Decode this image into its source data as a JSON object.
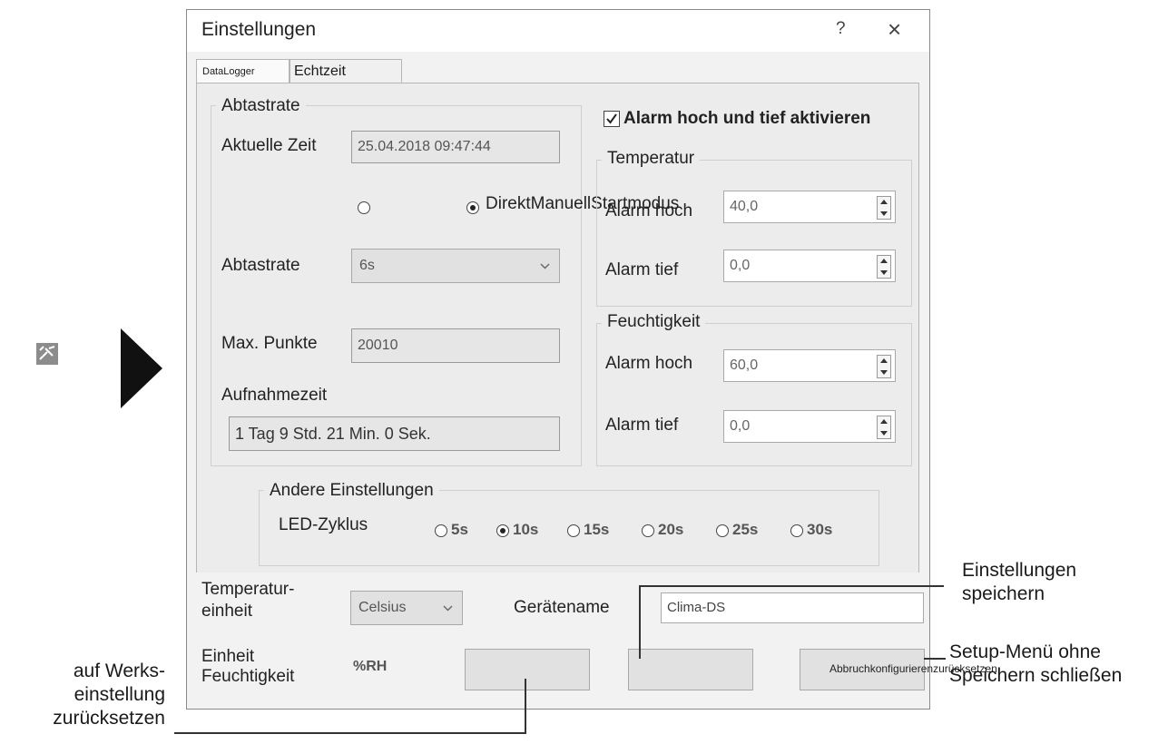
{
  "dialog": {
    "title": "Einstellungen",
    "help_label": "?",
    "close_label": "×"
  },
  "tabs": [
    {
      "label": "DataLogger"
    },
    {
      "label": "Echtzeit"
    }
  ],
  "abtastrate_group": {
    "title": "Abtastrate",
    "aktuelle_zeit_label": "Aktuelle Zeit",
    "aktuelle_zeit_value": "25.04.2018 09:47:44",
    "mode_options": [
      {
        "label": "",
        "selected": false
      },
      {
        "label": "DirektManuellStartmodus",
        "selected": true
      }
    ],
    "abtastrate_label": "Abtastrate",
    "abtastrate_value": "6s",
    "max_punkte_label": "Max. Punkte",
    "max_punkte_value": "20010",
    "aufnahmezeit_label": "Aufnahmezeit",
    "aufnahmezeit_value": "1 Tag  9 Std.  21 Min.  0 Sek."
  },
  "alarm": {
    "checkbox_label": "Alarm hoch und tief aktivieren",
    "checked": true,
    "temperatur": {
      "title": "Temperatur",
      "hoch_label": "Alarm hoch",
      "hoch_value": "40,0",
      "tief_label": "Alarm tief",
      "tief_value": "0,0"
    },
    "feuchtigkeit": {
      "title": "Feuchtigkeit",
      "hoch_label": "Alarm hoch",
      "hoch_value": "60,0",
      "tief_label": "Alarm tief",
      "tief_value": "0,0"
    }
  },
  "andere": {
    "title": "Andere Einstellungen",
    "led_label": "LED-Zyklus",
    "led_options": [
      {
        "label": "5s",
        "selected": false
      },
      {
        "label": "10s",
        "selected": true
      },
      {
        "label": "15s",
        "selected": false
      },
      {
        "label": "20s",
        "selected": false
      },
      {
        "label": "25s",
        "selected": false
      },
      {
        "label": "30s",
        "selected": false
      }
    ]
  },
  "bottom": {
    "temp_unit_label_1": "Temperatur-",
    "temp_unit_label_2": "einheit",
    "temp_unit_value": "Celsius",
    "geraetename_label": "Gerätename",
    "geraetename_value": "Clima-DS",
    "feucht_label_1": "Einheit",
    "feucht_label_2": "Feuchtigkeit",
    "feucht_value": "%RH",
    "buttons_caption": "Abbruchkonfigurierenzurücksetzen"
  },
  "annotations": {
    "save_1": "Einstellungen",
    "save_2": "speichern",
    "cancel_1": "Setup-Menü ohne",
    "cancel_2": "Speichern schließen",
    "reset_1": "auf Werks-",
    "reset_2": "einstellung",
    "reset_3": "zurücksetzen"
  }
}
